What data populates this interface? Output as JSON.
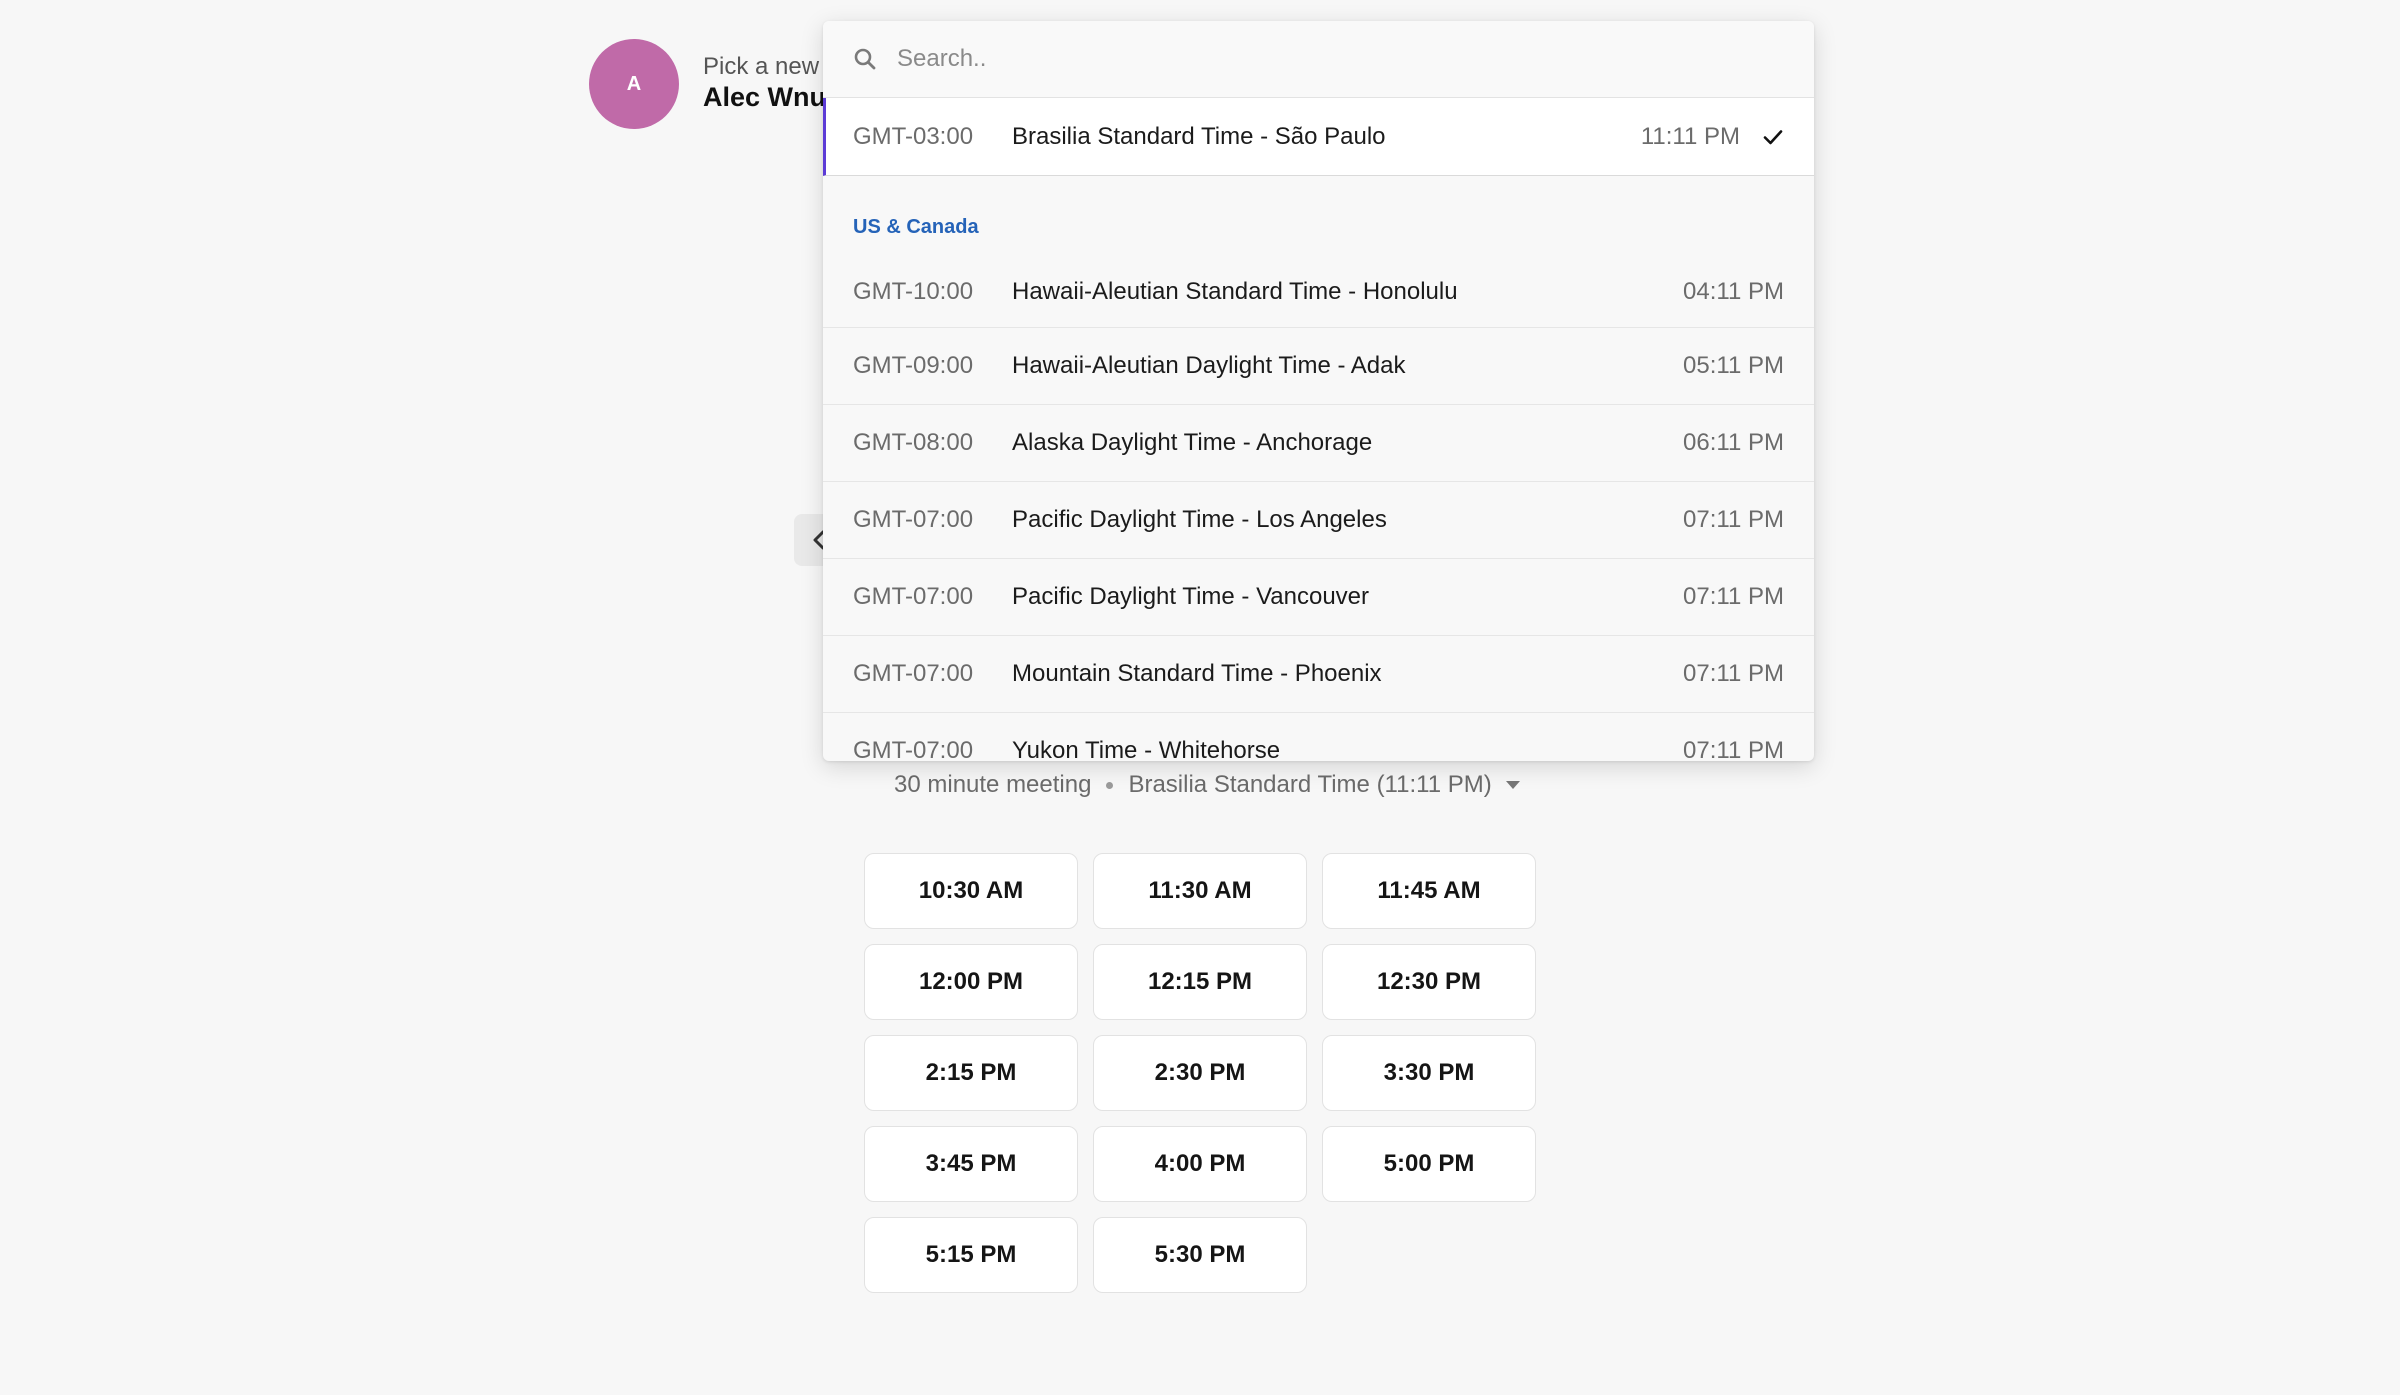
{
  "host": {
    "avatar_initial": "A",
    "avatar_color": "#c06aa8",
    "subtitle": "Pick a new",
    "name": "Alec Wnu"
  },
  "timezone_picker": {
    "search_placeholder": "Search..",
    "selected": {
      "offset": "GMT-03:00",
      "name": "Brasilia Standard Time - São Paulo",
      "time": "11:11 PM",
      "accent_color": "#5c3bd6"
    },
    "group": {
      "label": "US & Canada",
      "color": "#2563b8",
      "items": [
        {
          "offset": "GMT-10:00",
          "name": "Hawaii-Aleutian Standard Time - Honolulu",
          "time": "04:11 PM"
        },
        {
          "offset": "GMT-09:00",
          "name": "Hawaii-Aleutian Daylight Time - Adak",
          "time": "05:11 PM"
        },
        {
          "offset": "GMT-08:00",
          "name": "Alaska Daylight Time - Anchorage",
          "time": "06:11 PM"
        },
        {
          "offset": "GMT-07:00",
          "name": "Pacific Daylight Time - Los Angeles",
          "time": "07:11 PM"
        },
        {
          "offset": "GMT-07:00",
          "name": "Pacific Daylight Time - Vancouver",
          "time": "07:11 PM"
        },
        {
          "offset": "GMT-07:00",
          "name": "Mountain Standard Time - Phoenix",
          "time": "07:11 PM"
        },
        {
          "offset": "GMT-07:00",
          "name": "Yukon Time - Whitehorse",
          "time": "07:11 PM"
        }
      ]
    }
  },
  "meeting": {
    "duration": "30 minute meeting",
    "timezone_label": "Brasilia Standard Time (11:11 PM)"
  },
  "time_slots": [
    "10:30 AM",
    "11:30 AM",
    "11:45 AM",
    "12:00 PM",
    "12:15 PM",
    "12:30 PM",
    "2:15 PM",
    "2:30 PM",
    "3:30 PM",
    "3:45 PM",
    "4:00 PM",
    "5:00 PM",
    "5:15 PM",
    "5:30 PM"
  ]
}
